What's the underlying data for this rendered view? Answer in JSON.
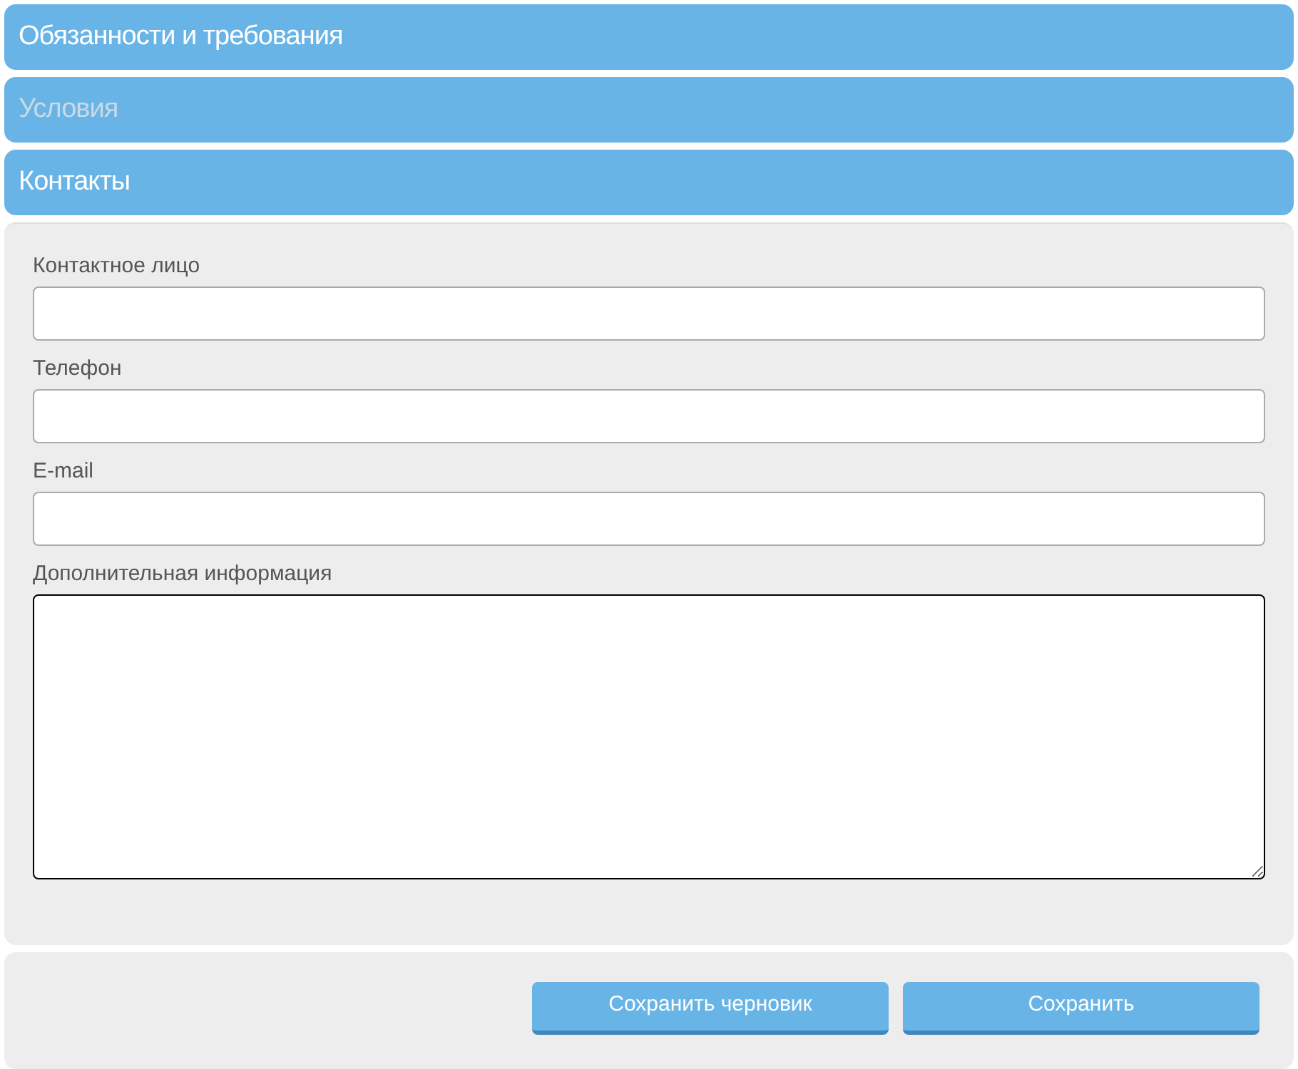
{
  "sections": [
    {
      "title": "Обязанности и требования",
      "disabled": false
    },
    {
      "title": "Условия",
      "disabled": true
    },
    {
      "title": "Контакты",
      "disabled": false,
      "fields": [
        {
          "kind": "input",
          "label": "Контактное лицо",
          "focused": false
        },
        {
          "kind": "input",
          "label": "Телефон",
          "focused": false
        },
        {
          "kind": "input",
          "label": "E-mail",
          "focused": false
        },
        {
          "kind": "textarea",
          "label": "Дополнительная информация",
          "focused": true
        }
      ]
    }
  ],
  "buttons": [
    "Сохранить черновик",
    "Сохранить"
  ]
}
